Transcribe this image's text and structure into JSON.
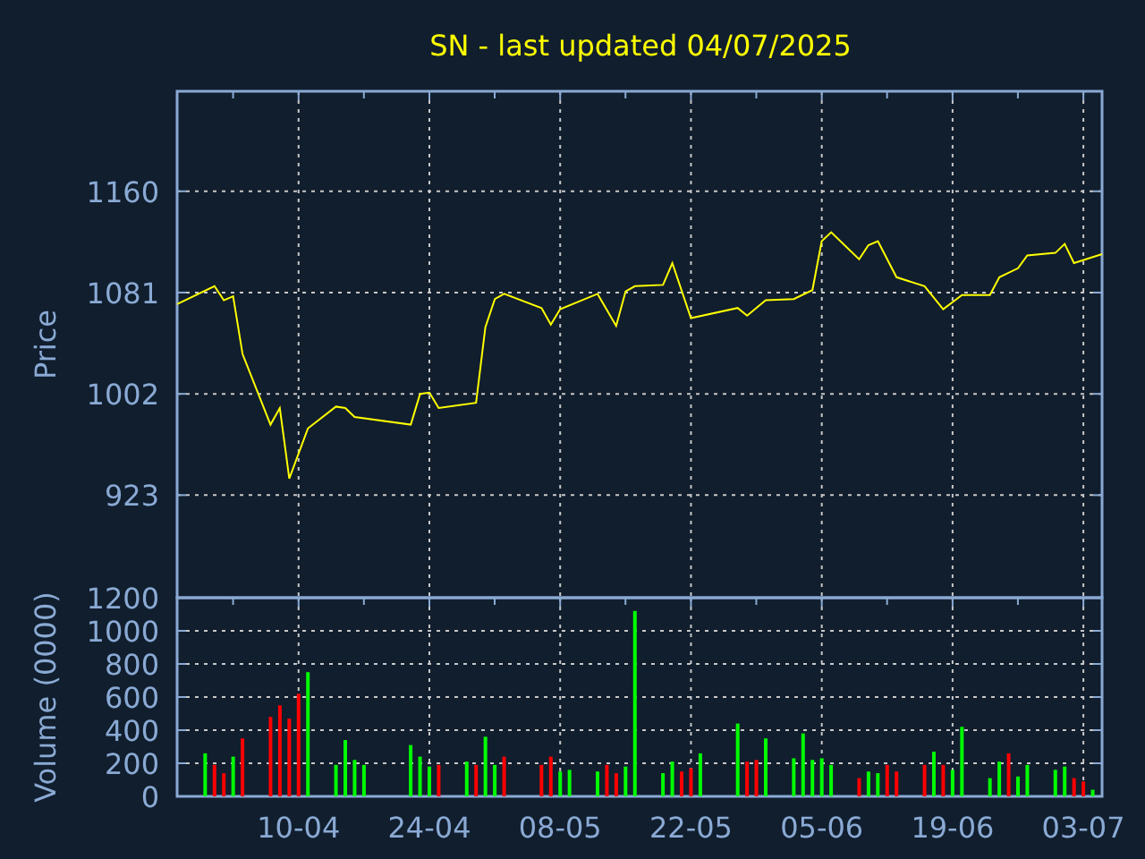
{
  "title": "SN - last updated 04/07/2025",
  "price_panel": {
    "chart_data": {
      "type": "line",
      "ylabel": "Price",
      "grid": true,
      "ylim": [
        843,
        1238
      ],
      "yticks": [
        {
          "value": 923,
          "label": "923"
        },
        {
          "value": 1002,
          "label": "1002"
        },
        {
          "value": 1081,
          "label": "1081"
        },
        {
          "value": 1160,
          "label": "1160"
        }
      ],
      "categories": [
        null,
        null,
        null,
        null,
        null,
        null,
        null,
        null,
        null,
        null,
        null,
        null,
        null,
        null,
        null,
        null,
        null,
        null,
        null,
        null,
        null,
        null,
        null,
        null,
        null,
        null,
        null,
        null,
        null,
        null,
        null,
        null,
        null,
        null,
        null,
        null,
        null,
        null,
        null,
        null,
        null,
        null,
        null,
        null,
        null,
        null,
        null,
        null,
        null,
        null,
        null,
        null,
        null,
        null,
        null,
        null,
        null,
        null,
        null,
        null,
        null,
        null,
        null,
        null,
        null,
        null,
        null,
        null,
        null,
        null,
        null,
        null,
        null,
        null,
        null,
        null,
        null,
        null,
        null,
        null,
        null,
        null,
        null,
        null,
        null,
        null,
        null,
        null,
        null,
        null,
        null,
        null,
        null,
        null,
        null,
        null,
        null,
        null,
        null,
        null
      ],
      "series": [
        {
          "color": "#ffff00",
          "values": [
            1072,
            null,
            null,
            null,
            1086,
            1075,
            1078,
            1033,
            null,
            null,
            978,
            991,
            936,
            null,
            975,
            null,
            null,
            992,
            991,
            984,
            null,
            null,
            null,
            null,
            null,
            978,
            1002,
            1003,
            991,
            null,
            null,
            null,
            995,
            1054,
            1076,
            1080,
            null,
            null,
            null,
            1069,
            1056,
            1068,
            null,
            null,
            null,
            1080,
            null,
            1055,
            1082,
            1086,
            null,
            null,
            1087,
            1104,
            null,
            1061,
            null,
            null,
            null,
            null,
            1069,
            1063,
            null,
            1075,
            null,
            null,
            1076,
            null,
            1083,
            1121,
            1128,
            null,
            null,
            1107,
            1118,
            1121,
            null,
            1093,
            null,
            null,
            1086,
            null,
            1068,
            null,
            1079,
            null,
            null,
            1079,
            1093,
            null,
            1100,
            1110,
            null,
            null,
            1112,
            1119,
            1104,
            null,
            null,
            1111
          ]
        }
      ]
    }
  },
  "volume_panel": {
    "chart_data": {
      "type": "bar",
      "ylabel": "Volume (0000)",
      "grid": true,
      "ylim": [
        0,
        1200
      ],
      "yticks": [
        0,
        200,
        400,
        600,
        800,
        1000,
        1200
      ],
      "categories": [
        null,
        null,
        null,
        null,
        null,
        null,
        null,
        null,
        null,
        null,
        null,
        null,
        null,
        "10-04",
        null,
        null,
        null,
        null,
        null,
        null,
        null,
        null,
        null,
        null,
        null,
        null,
        null,
        "24-04",
        null,
        null,
        null,
        null,
        null,
        null,
        null,
        null,
        null,
        null,
        null,
        null,
        null,
        "08-05",
        null,
        null,
        null,
        null,
        null,
        null,
        null,
        null,
        null,
        null,
        null,
        null,
        null,
        "22-05",
        null,
        null,
        null,
        null,
        null,
        null,
        null,
        null,
        null,
        null,
        null,
        null,
        null,
        "05-06",
        null,
        null,
        null,
        null,
        null,
        null,
        null,
        null,
        null,
        null,
        null,
        null,
        null,
        "19-06",
        null,
        null,
        null,
        null,
        null,
        null,
        null,
        null,
        null,
        null,
        null,
        null,
        null,
        "03-07",
        null,
        null
      ],
      "series": [
        {
          "color": "#00ff00",
          "values": [
            null,
            null,
            null,
            260,
            null,
            null,
            240,
            null,
            null,
            null,
            null,
            null,
            null,
            null,
            750,
            null,
            null,
            190,
            340,
            220,
            190,
            null,
            null,
            null,
            null,
            310,
            240,
            180,
            null,
            null,
            null,
            210,
            null,
            360,
            190,
            null,
            null,
            null,
            null,
            null,
            null,
            150,
            160,
            null,
            null,
            150,
            null,
            null,
            180,
            1120,
            null,
            null,
            140,
            210,
            null,
            null,
            260,
            null,
            null,
            null,
            440,
            null,
            null,
            350,
            null,
            null,
            230,
            380,
            220,
            230,
            190,
            null,
            null,
            null,
            150,
            140,
            null,
            null,
            null,
            null,
            null,
            270,
            null,
            160,
            420,
            null,
            null,
            110,
            210,
            null,
            120,
            190,
            null,
            null,
            160,
            180,
            null,
            null,
            40,
            null
          ]
        },
        {
          "color": "#ff0000",
          "values": [
            null,
            null,
            null,
            null,
            190,
            140,
            null,
            350,
            null,
            null,
            480,
            550,
            470,
            620,
            null,
            null,
            null,
            null,
            null,
            null,
            null,
            null,
            null,
            null,
            null,
            null,
            null,
            null,
            190,
            null,
            null,
            null,
            190,
            null,
            null,
            240,
            null,
            null,
            null,
            190,
            240,
            null,
            null,
            null,
            null,
            null,
            190,
            140,
            null,
            null,
            null,
            null,
            null,
            null,
            150,
            170,
            null,
            null,
            null,
            null,
            null,
            210,
            220,
            null,
            null,
            null,
            null,
            null,
            null,
            null,
            null,
            null,
            null,
            110,
            null,
            null,
            190,
            150,
            null,
            null,
            190,
            null,
            190,
            null,
            null,
            null,
            null,
            null,
            null,
            260,
            null,
            null,
            null,
            null,
            null,
            null,
            110,
            90,
            null,
            null
          ]
        }
      ]
    }
  }
}
